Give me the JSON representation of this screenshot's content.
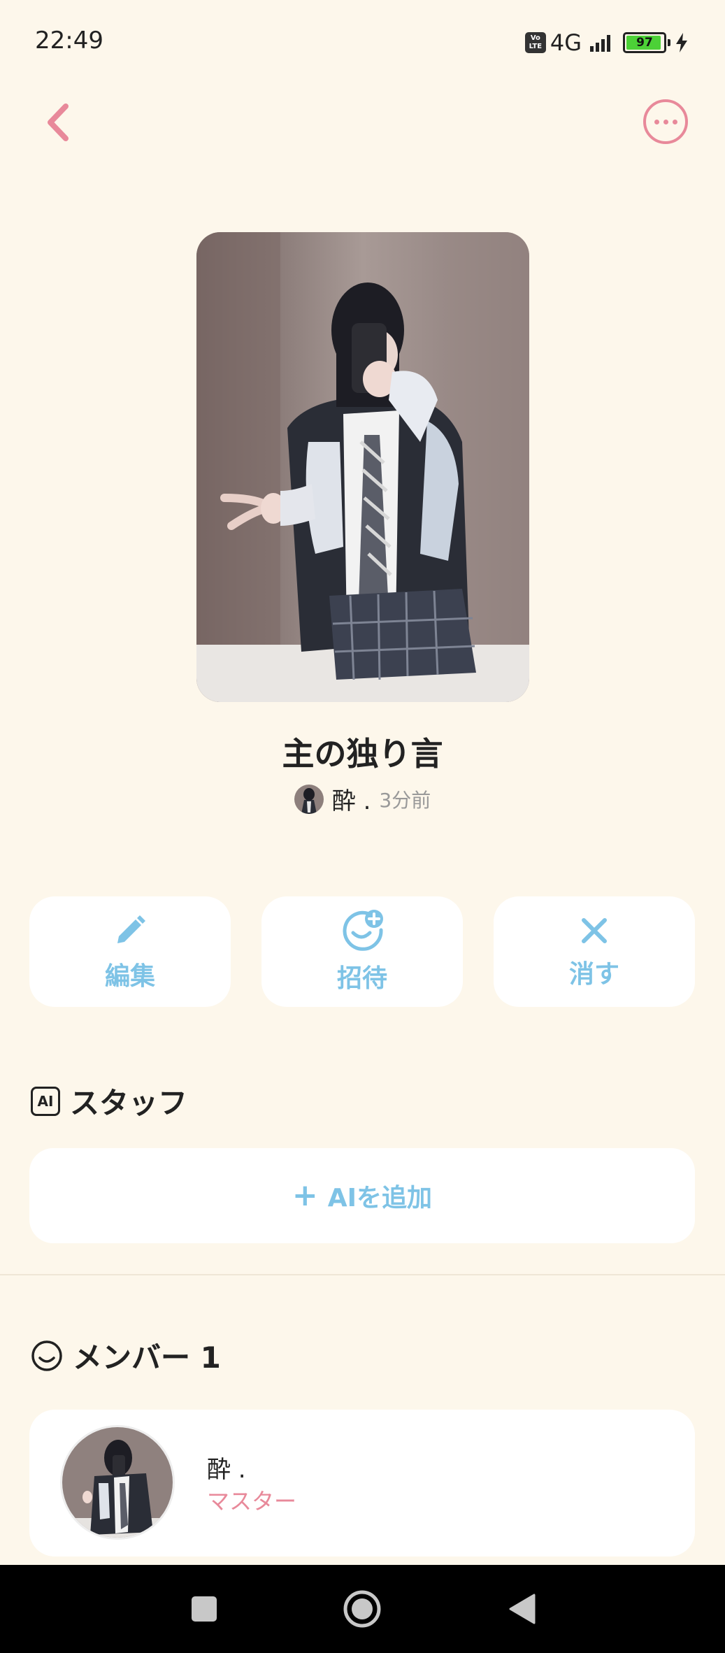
{
  "status_bar": {
    "time": "22:49",
    "volte": "Vo LTE",
    "network": "4G",
    "battery": "97"
  },
  "header": {
    "back_icon": "chevron-left-icon",
    "more_icon": "more-dots-icon"
  },
  "room": {
    "title": "主の独り言",
    "owner_name": "酔 .",
    "updated": "3分前"
  },
  "actions": [
    {
      "label": "編集",
      "icon": "pencil-icon"
    },
    {
      "label": "招待",
      "icon": "add-user-icon"
    },
    {
      "label": "消す",
      "icon": "close-icon"
    }
  ],
  "staff": {
    "icon_text": "AI",
    "heading": "スタッフ",
    "add_label": "AIを追加"
  },
  "members": {
    "heading": "メンバー 1",
    "list": [
      {
        "name": "酔 .",
        "role": "マスター"
      }
    ]
  },
  "colors": {
    "background": "#fdf7eb",
    "accent_pink": "#e8899a",
    "accent_blue": "#7ec3e6",
    "card": "#ffffff"
  }
}
